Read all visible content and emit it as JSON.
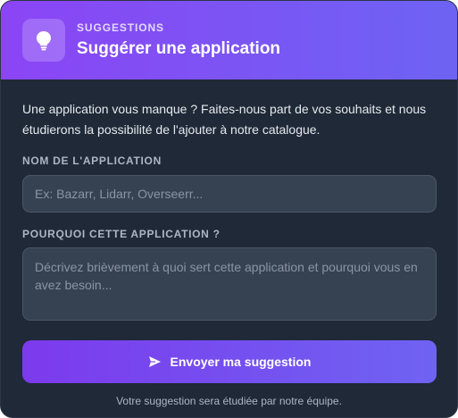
{
  "header": {
    "icon": "lightbulb-icon",
    "eyebrow": "SUGGESTIONS",
    "title": "Suggérer une application"
  },
  "intro": "Une application vous manque ? Faites-nous part de vos souhaits et nous étudierons la possibilité de l'ajouter à notre catalogue.",
  "form": {
    "app_name": {
      "label": "NOM DE L'APPLICATION",
      "value": "",
      "placeholder": "Ex: Bazarr, Lidarr, Overseerr..."
    },
    "reason": {
      "label": "POURQUOI CETTE APPLICATION ?",
      "value": "",
      "placeholder": "Décrivez brièvement à quoi sert cette application et pourquoi vous en avez besoin..."
    },
    "submit": {
      "icon": "send-icon",
      "label": "Envoyer ma suggestion"
    }
  },
  "footnote": "Votre suggestion sera étudiée par notre équipe.",
  "colors": {
    "gradient_start": "#8b45f5",
    "gradient_end": "#6d63f3",
    "card_background": "#1f2937",
    "input_background": "#364152"
  }
}
